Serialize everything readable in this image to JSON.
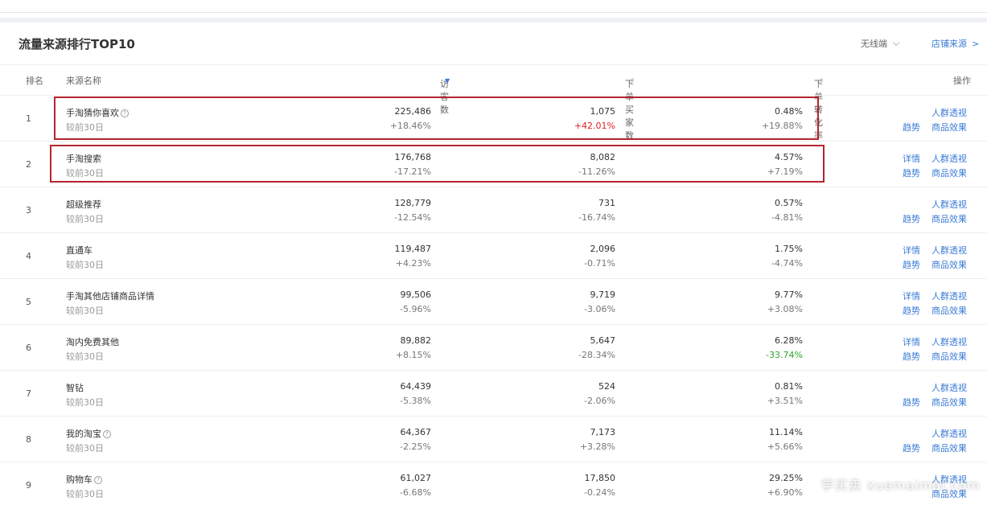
{
  "header": {
    "title": "流量来源排行TOP10",
    "device_select": "无线端",
    "shop_source_link": "店铺来源",
    "shop_source_arrow": ">"
  },
  "columns": {
    "rank": "排名",
    "name": "来源名称",
    "visitors": "访客数",
    "buyers": "下单买家数",
    "conversion": "下单转化率",
    "action": "操作"
  },
  "sort_icons": {
    "visitors": "▼",
    "buyers": "⇕",
    "conversion": "⇕"
  },
  "rows": [
    {
      "rank": "1",
      "name": "手淘猜你喜欢",
      "help": "?",
      "compare": "较前30日",
      "visitors": "225,486",
      "visitors_delta": "+18.46%",
      "buyers": "1,075",
      "buyers_delta": "+42.01%",
      "conv": "0.48%",
      "conv_delta": "+19.88%",
      "op_detail": "",
      "op_trend": "趋势",
      "op_crowd": "人群透视",
      "op_goods": "商品效果"
    },
    {
      "rank": "2",
      "name": "手淘搜索",
      "help": "",
      "compare": "较前30日",
      "visitors": "176,768",
      "visitors_delta": "-17.21%",
      "buyers": "8,082",
      "buyers_delta": "-11.26%",
      "conv": "4.57%",
      "conv_delta": "+7.19%",
      "op_detail": "详情",
      "op_trend": "趋势",
      "op_crowd": "人群透视",
      "op_goods": "商品效果"
    },
    {
      "rank": "3",
      "name": "超级推荐",
      "help": "",
      "compare": "较前30日",
      "visitors": "128,779",
      "visitors_delta": "-12.54%",
      "buyers": "731",
      "buyers_delta": "-16.74%",
      "conv": "0.57%",
      "conv_delta": "-4.81%",
      "op_detail": "",
      "op_trend": "趋势",
      "op_crowd": "人群透视",
      "op_goods": "商品效果"
    },
    {
      "rank": "4",
      "name": "直通车",
      "help": "",
      "compare": "较前30日",
      "visitors": "119,487",
      "visitors_delta": "+4.23%",
      "buyers": "2,096",
      "buyers_delta": "-0.71%",
      "conv": "1.75%",
      "conv_delta": "-4.74%",
      "op_detail": "详情",
      "op_trend": "趋势",
      "op_crowd": "人群透视",
      "op_goods": "商品效果"
    },
    {
      "rank": "5",
      "name": "手淘其他店铺商品详情",
      "help": "",
      "compare": "较前30日",
      "visitors": "99,506",
      "visitors_delta": "-5.96%",
      "buyers": "9,719",
      "buyers_delta": "-3.06%",
      "conv": "9.77%",
      "conv_delta": "+3.08%",
      "op_detail": "详情",
      "op_trend": "趋势",
      "op_crowd": "人群透视",
      "op_goods": "商品效果"
    },
    {
      "rank": "6",
      "name": "淘内免费其他",
      "help": "",
      "compare": "较前30日",
      "visitors": "89,882",
      "visitors_delta": "+8.15%",
      "buyers": "5,647",
      "buyers_delta": "-28.34%",
      "conv": "6.28%",
      "conv_delta": "-33.74%",
      "op_detail": "详情",
      "op_trend": "趋势",
      "op_crowd": "人群透视",
      "op_goods": "商品效果"
    },
    {
      "rank": "7",
      "name": "智钻",
      "help": "",
      "compare": "较前30日",
      "visitors": "64,439",
      "visitors_delta": "-5.38%",
      "buyers": "524",
      "buyers_delta": "-2.06%",
      "conv": "0.81%",
      "conv_delta": "+3.51%",
      "op_detail": "",
      "op_trend": "趋势",
      "op_crowd": "人群透视",
      "op_goods": "商品效果"
    },
    {
      "rank": "8",
      "name": "我的淘宝",
      "help": "?",
      "compare": "较前30日",
      "visitors": "64,367",
      "visitors_delta": "-2.25%",
      "buyers": "7,173",
      "buyers_delta": "+3.28%",
      "conv": "11.14%",
      "conv_delta": "+5.66%",
      "op_detail": "",
      "op_trend": "趋势",
      "op_crowd": "人群透视",
      "op_goods": "商品效果"
    },
    {
      "rank": "9",
      "name": "购物车",
      "help": "?",
      "compare": "较前30日",
      "visitors": "61,027",
      "visitors_delta": "-6.68%",
      "buyers": "17,850",
      "buyers_delta": "-0.24%",
      "conv": "29.25%",
      "conv_delta": "+6.90%",
      "op_detail": "",
      "op_trend": "",
      "op_crowd": "人群透视",
      "op_goods": "商品效果"
    }
  ],
  "highlight_colors": {
    "box": "#b3252c",
    "positive_emphasis": "#e02020",
    "negative_emphasis": "#2aa52a",
    "link": "#3a7bd5"
  },
  "watermark": "学买卖 xuemaimai.com"
}
